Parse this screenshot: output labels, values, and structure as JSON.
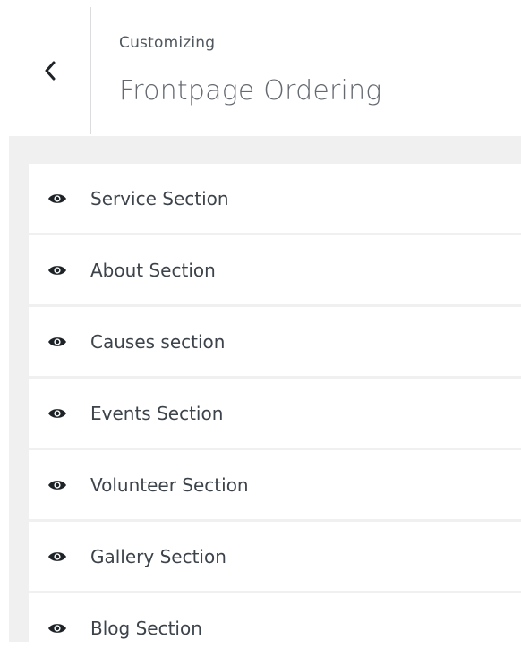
{
  "header": {
    "subtitle": "Customizing",
    "title": "Frontpage Ordering",
    "back_icon": "chevron-left-icon"
  },
  "sections": [
    {
      "label": "Service Section",
      "icon": "eye-icon"
    },
    {
      "label": "About Section",
      "icon": "eye-icon"
    },
    {
      "label": "Causes section",
      "icon": "eye-icon"
    },
    {
      "label": "Events Section",
      "icon": "eye-icon"
    },
    {
      "label": "Volunteer Section",
      "icon": "eye-icon"
    },
    {
      "label": "Gallery Section",
      "icon": "eye-icon"
    },
    {
      "label": "Blog Section",
      "icon": "eye-icon"
    }
  ],
  "colors": {
    "panel_background": "#f0f0f1",
    "item_background": "#ffffff",
    "text": "#3c434a"
  }
}
